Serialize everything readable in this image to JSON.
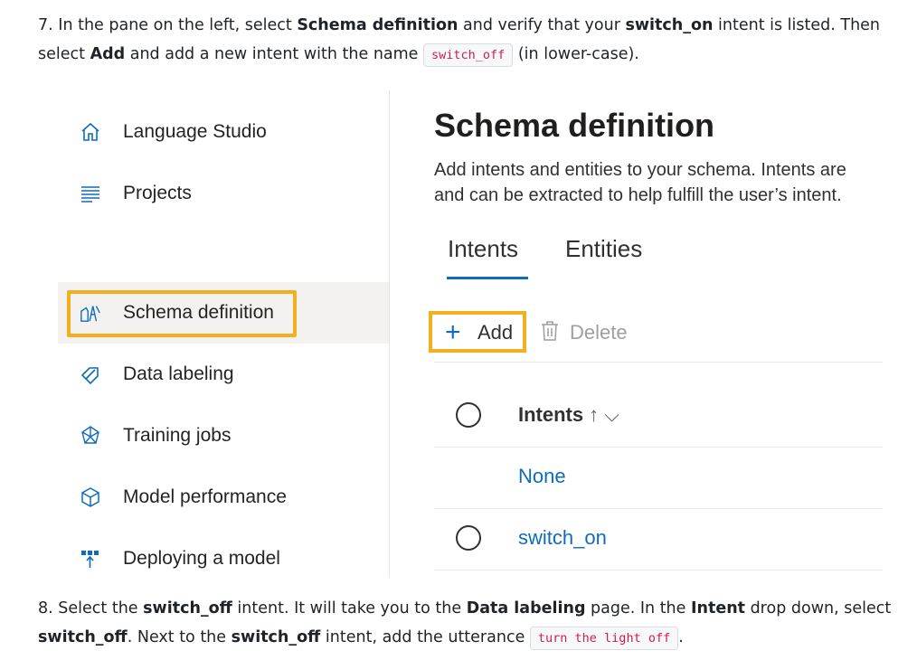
{
  "step7": {
    "num": "7.",
    "t1": "In the pane on the left, select ",
    "b1": "Schema definition",
    "t2": " and verify that your ",
    "b2": "switch_on",
    "t3": " intent is listed. Then select ",
    "b3": "Add",
    "t4": " and add a new intent with the name ",
    "code": "switch_off",
    "t5": " (in lower-case)."
  },
  "sidebar": {
    "items": [
      {
        "label": "Language Studio",
        "icon": "home-icon"
      },
      {
        "label": "Projects",
        "icon": "list-icon"
      },
      {
        "label": "Schema definition",
        "icon": "schema-icon"
      },
      {
        "label": "Data labeling",
        "icon": "tag-icon"
      },
      {
        "label": "Training jobs",
        "icon": "network-icon"
      },
      {
        "label": "Model performance",
        "icon": "cube-icon"
      },
      {
        "label": "Deploying a model",
        "icon": "deploy-icon"
      }
    ]
  },
  "main": {
    "title": "Schema definition",
    "desc_line1": "Add intents and entities to your schema. Intents are",
    "desc_line2": "and can be extracted to help fulfill the user’s intent.",
    "tabs": [
      "Intents",
      "Entities"
    ],
    "toolbar": {
      "add": "Add",
      "delete": "Delete"
    },
    "table": {
      "header": "Intents",
      "header_sort": "↑ ⌵",
      "rows": [
        "None",
        "switch_on"
      ]
    }
  },
  "step8": {
    "num": "8.",
    "t1": "Select the ",
    "b1": "switch_off",
    "t2": " intent. It will take you to the ",
    "b2": "Data labeling",
    "t3": " page. In the ",
    "b3": "Intent",
    "t4": " drop down, select ",
    "b4": "switch_off",
    "t5": ". Next to the ",
    "b5": "switch_off",
    "t6": " intent, add the utterance ",
    "code": "turn the light off",
    "t7": "."
  },
  "colors": {
    "accent": "#0f6cbd",
    "highlight": "#f2b01e",
    "code": "#d01c4e"
  }
}
